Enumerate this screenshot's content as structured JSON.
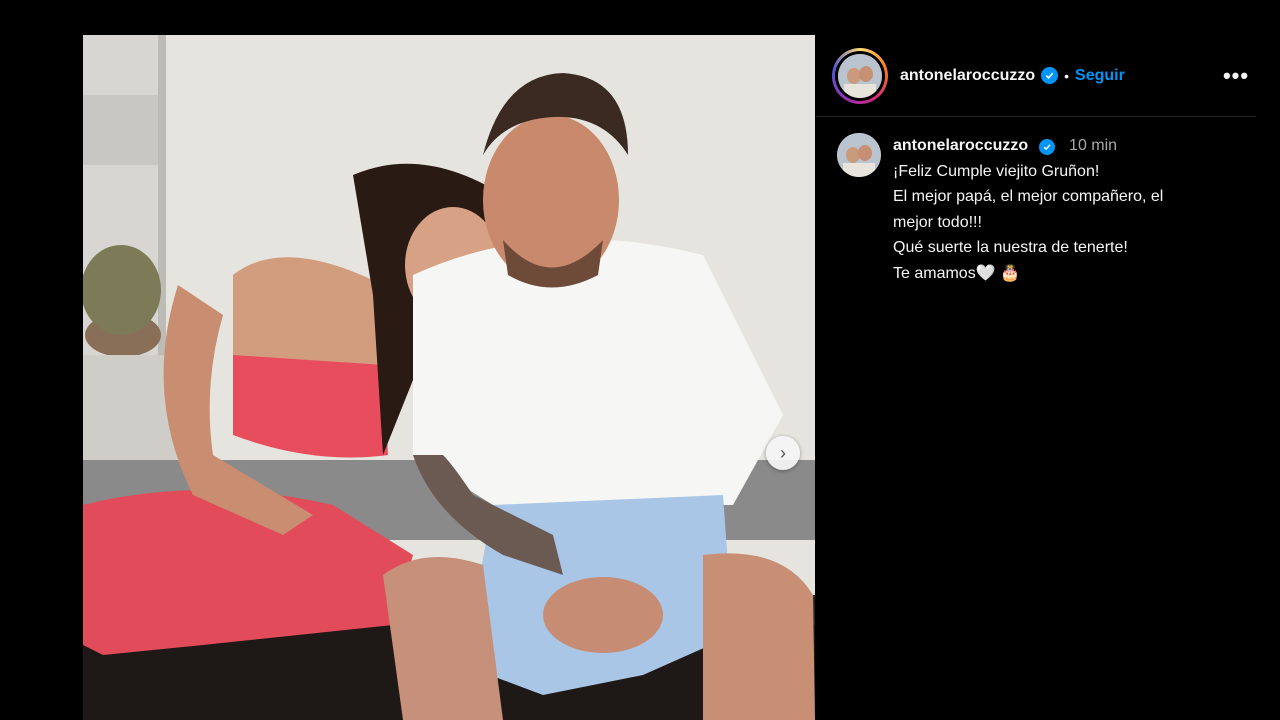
{
  "post": {
    "image_alt": "",
    "next_arrow": "›"
  },
  "header": {
    "username": "antonelaroccuzzo",
    "separator": "•",
    "follow_label": "Seguir",
    "more_label": "•••"
  },
  "caption": {
    "username": "antonelaroccuzzo",
    "time": "10 min",
    "lines": [
      "¡Feliz Cumple viejito Gruñon!",
      "El mejor papá, el mejor compañero, el",
      "mejor todo!!!",
      "Qué suerte la nuestra de tenerte!",
      "Te amamos🤍 🎂"
    ]
  },
  "colors": {
    "background": "#000000",
    "link_blue": "#0095f6",
    "text": "#f5f5f5",
    "muted": "#a8a8a8"
  },
  "icons": {
    "verified": "verified-badge-icon",
    "next": "chevron-right-icon",
    "more": "more-horizontal-icon"
  }
}
